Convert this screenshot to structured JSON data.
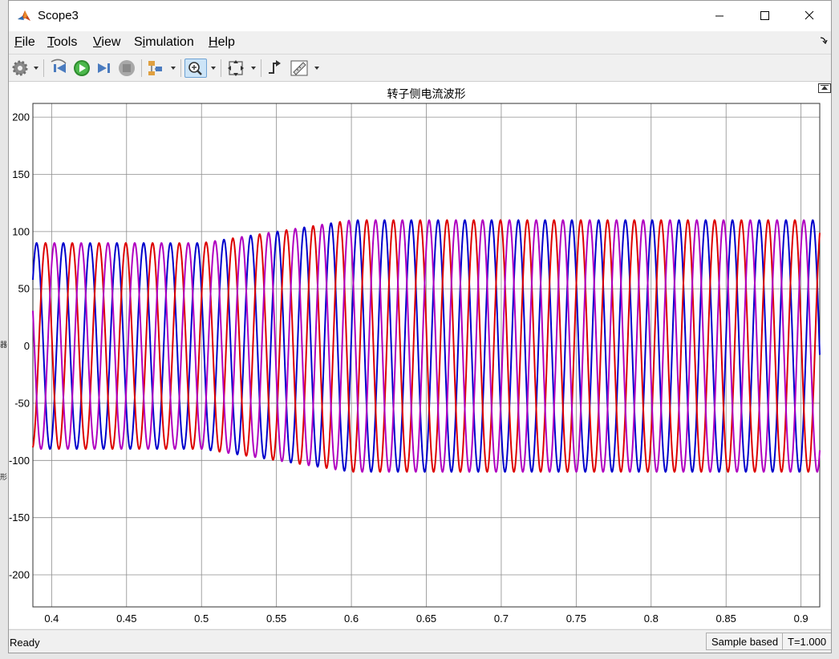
{
  "window": {
    "title": "Scope3",
    "app_icon": "matlab-icon",
    "controls": [
      "minimize-icon",
      "maximize-icon",
      "close-icon"
    ]
  },
  "menu": {
    "items": [
      {
        "label": "File",
        "mnemonic": "F"
      },
      {
        "label": "Tools",
        "mnemonic": "T"
      },
      {
        "label": "View",
        "mnemonic": "V"
      },
      {
        "label": "Simulation",
        "mnemonic": "i"
      },
      {
        "label": "Help",
        "mnemonic": "H"
      }
    ]
  },
  "toolbar": {
    "icons": [
      "gear-icon",
      "step-back-icon",
      "run-icon",
      "step-forward-icon",
      "stop-icon",
      "highlight-block-icon",
      "zoom-in-icon",
      "fit-to-view-icon",
      "triggers-icon",
      "measure-icon"
    ],
    "active": "zoom-in-icon"
  },
  "chart_data": {
    "type": "line",
    "title": "转子侧电流波形",
    "xlim": [
      0.3875,
      0.9125
    ],
    "ylim": [
      -228,
      212
    ],
    "xticks": [
      0.4,
      0.45,
      0.5,
      0.55,
      0.6,
      0.65,
      0.7,
      0.75,
      0.8,
      0.85,
      0.9
    ],
    "yticks": [
      -200,
      -150,
      -100,
      -50,
      0,
      50,
      100,
      150,
      200
    ],
    "grid": true,
    "background": "#ffffff",
    "signal": {
      "frequency_hz": 56,
      "amplitude_before": 90,
      "amplitude_after": 110,
      "transition_start": 0.5,
      "transition_end": 0.6
    },
    "series": [
      {
        "color": "#0000cc",
        "phase_at_x0_deg": 40
      },
      {
        "color": "#dd0000",
        "phase_at_x0_deg": -80
      },
      {
        "color": "#b000c0",
        "phase_at_x0_deg": 160
      }
    ]
  },
  "status": {
    "ready": "Ready",
    "sample_mode": "Sample based",
    "time": "T=1.000"
  },
  "background_fragments": [
    "器",
    "形"
  ]
}
